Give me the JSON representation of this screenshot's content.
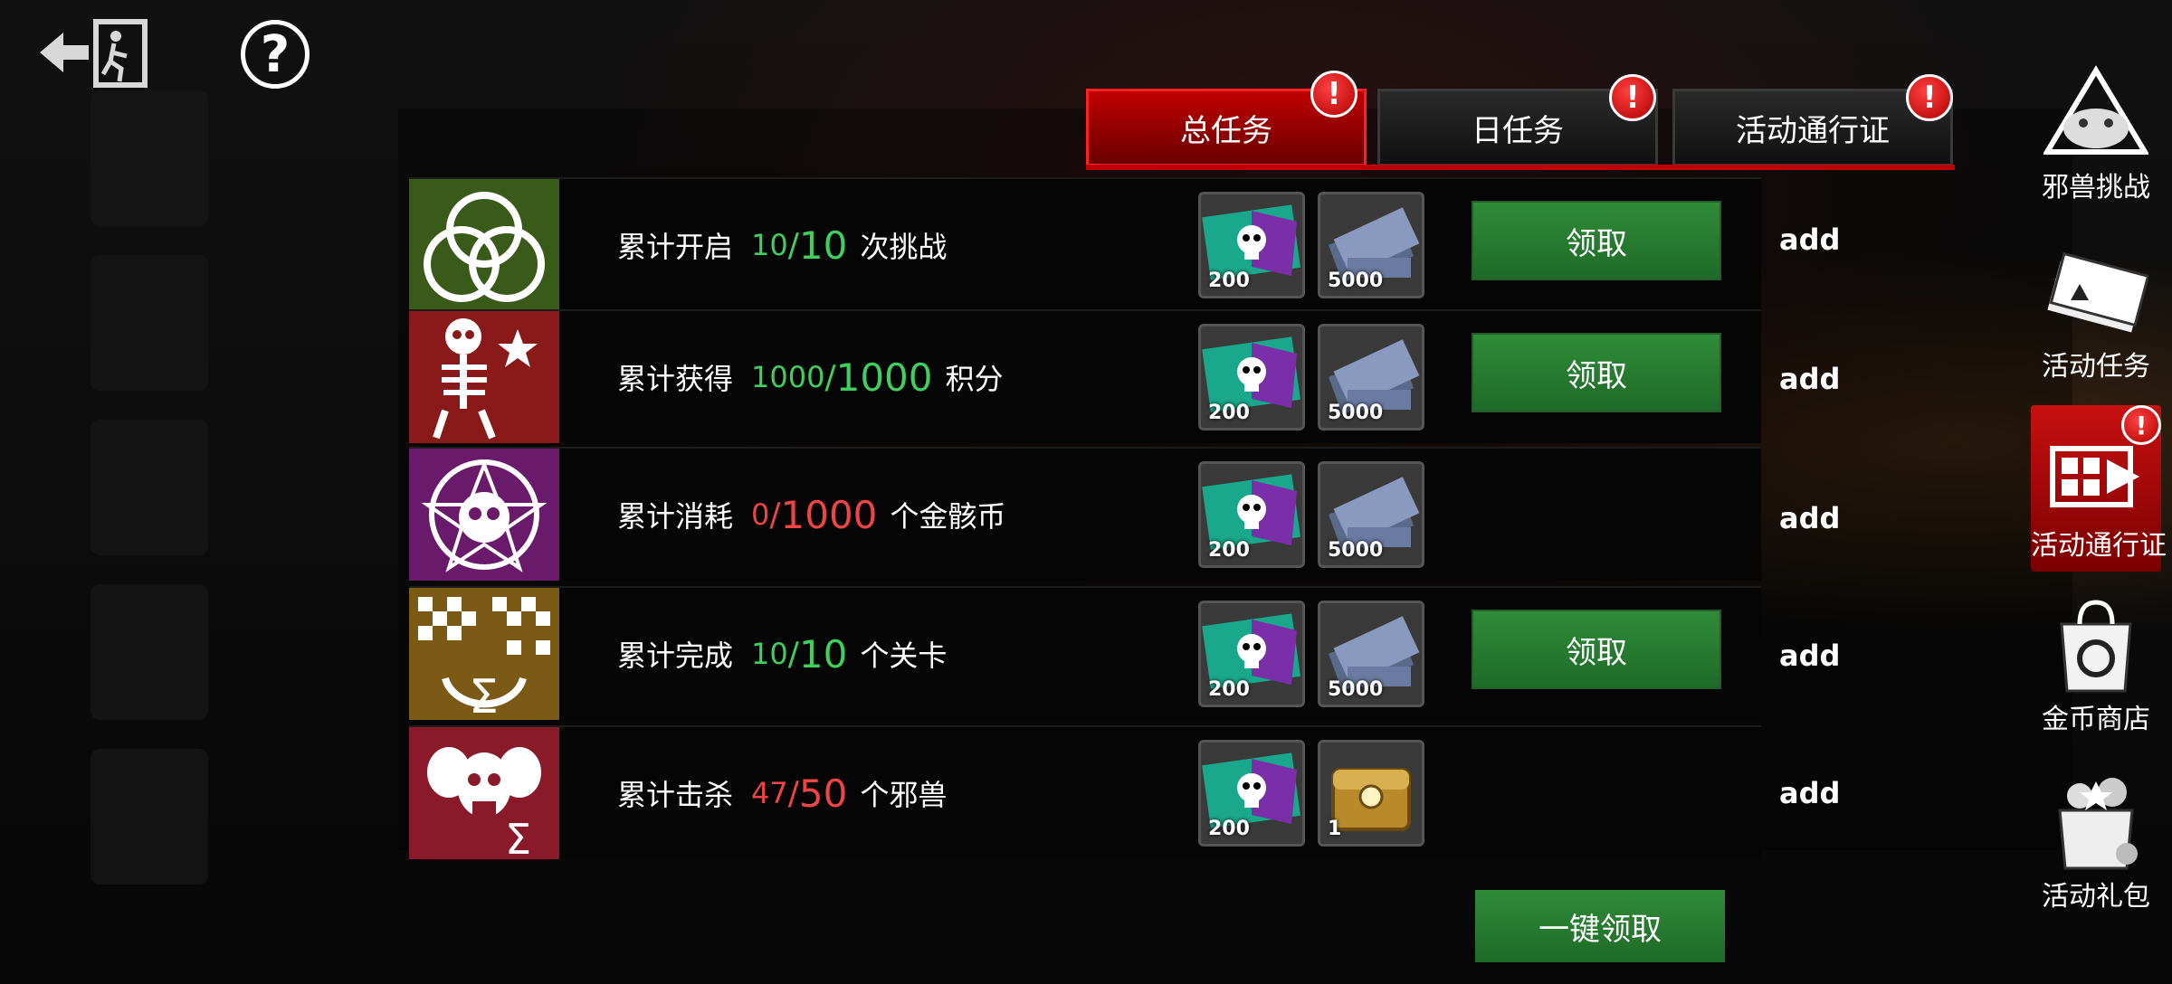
{
  "tabs": [
    {
      "label": "总任务",
      "alert": "!"
    },
    {
      "label": "日任务",
      "alert": "!"
    },
    {
      "label": "活动通行证",
      "alert": "!"
    }
  ],
  "tasks": [
    {
      "prefix": "累计开启",
      "current": "10",
      "total": "10",
      "suffix": "次挑战",
      "status": "green",
      "rewards": [
        {
          "icon": "skull-ticket-icon",
          "count": "200"
        },
        {
          "icon": "cash-stack-icon",
          "count": "5000"
        }
      ],
      "claim": "领取",
      "add": "add"
    },
    {
      "prefix": "累计获得",
      "current": "1000",
      "total": "1000",
      "suffix": "积分",
      "status": "green",
      "rewards": [
        {
          "icon": "skull-ticket-icon",
          "count": "200"
        },
        {
          "icon": "cash-stack-icon",
          "count": "5000"
        }
      ],
      "claim": "领取",
      "add": "add"
    },
    {
      "prefix": "累计消耗",
      "current": "0",
      "total": "1000",
      "suffix": "个金骸币",
      "status": "red",
      "rewards": [
        {
          "icon": "skull-ticket-icon",
          "count": "200"
        },
        {
          "icon": "cash-stack-icon",
          "count": "5000"
        }
      ],
      "claim": "",
      "add": "add"
    },
    {
      "prefix": "累计完成",
      "current": "10",
      "total": "10",
      "suffix": "个关卡",
      "status": "green",
      "rewards": [
        {
          "icon": "skull-ticket-icon",
          "count": "200"
        },
        {
          "icon": "cash-stack-icon",
          "count": "5000"
        }
      ],
      "claim": "领取",
      "add": "add"
    },
    {
      "prefix": "累计击杀",
      "current": "47",
      "total": "50",
      "suffix": "个邪兽",
      "status": "red",
      "rewards": [
        {
          "icon": "skull-ticket-icon",
          "count": "200"
        },
        {
          "icon": "gold-chest-icon",
          "count": "1"
        }
      ],
      "claim": "",
      "add": "add"
    }
  ],
  "claim_all": "一键领取",
  "help_icon": "?",
  "nav": [
    {
      "label": "邪兽挑战",
      "icon": "beast-challenge-icon"
    },
    {
      "label": "活动任务",
      "icon": "ticket-icon"
    },
    {
      "label": "活动通行证",
      "icon": "pass-card-icon",
      "alert": "!"
    },
    {
      "label": "金币商店",
      "icon": "shopping-bag-icon"
    },
    {
      "label": "活动礼包",
      "icon": "gift-bag-icon"
    }
  ],
  "colors": {
    "accent_red": "#c00000",
    "claim_green": "#2f8c38",
    "progress_green": "#3fcf5c",
    "progress_red": "#ee4444"
  }
}
